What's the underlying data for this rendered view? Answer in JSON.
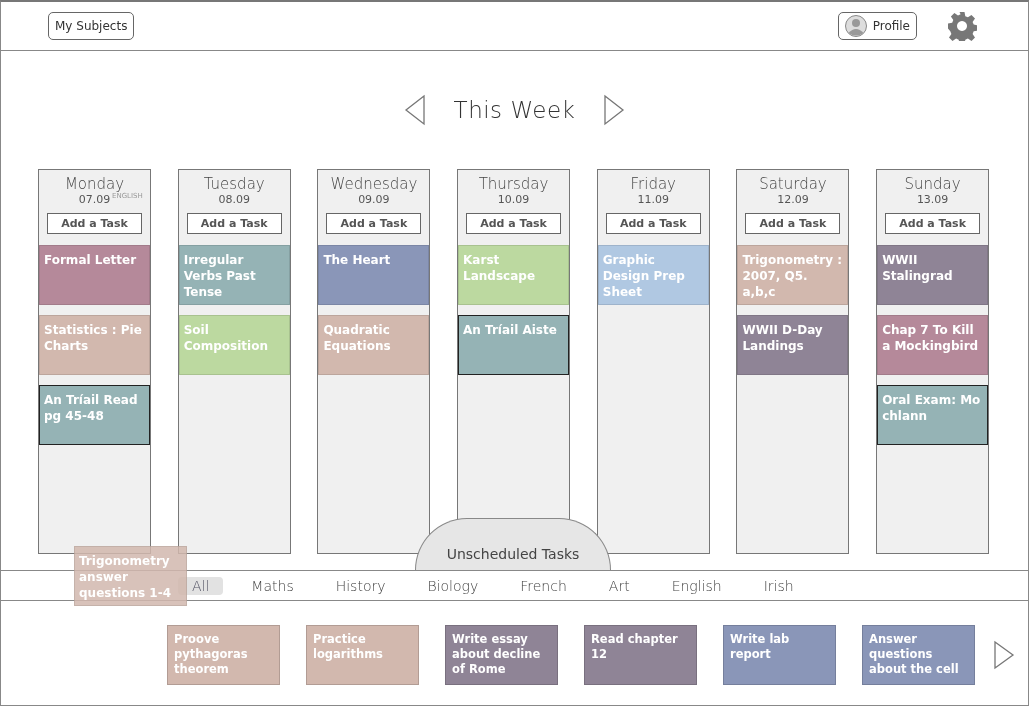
{
  "header": {
    "subjects_button": "My Subjects",
    "profile_button": "Profile"
  },
  "week": {
    "title": "This Week"
  },
  "days": [
    {
      "name": "Monday",
      "date": "07.09",
      "tag": "ENGLISH",
      "add_button": "Add a Task",
      "tasks": [
        {
          "title": "Formal  Letter",
          "color": "#b5899a",
          "outlined": false
        },
        {
          "title": "Statistics : Pie Charts",
          "color": "#d2b8ae",
          "outlined": false
        },
        {
          "title": "An Tríail Read pg 45-48",
          "color": "#95b3b5",
          "outlined": true
        }
      ]
    },
    {
      "name": "Tuesday",
      "date": "08.09",
      "add_button": "Add a Task",
      "tasks": [
        {
          "title": "Irregular Verbs Past Tense",
          "color": "#95b3b5",
          "outlined": false
        },
        {
          "title": "Soil Composition",
          "color": "#bcd9a0",
          "outlined": false
        }
      ]
    },
    {
      "name": "Wednesday",
      "date": "09.09",
      "add_button": "Add a Task",
      "tasks": [
        {
          "title": "The Heart",
          "color": "#8a96b8",
          "outlined": false
        },
        {
          "title": "Quadratic Equations",
          "color": "#d2b8ae",
          "outlined": false
        }
      ]
    },
    {
      "name": "Thursday",
      "date": "10.09",
      "add_button": "Add a Task",
      "tasks": [
        {
          "title": "Karst Landscape",
          "color": "#bcd9a0",
          "outlined": false
        },
        {
          "title": "An Tríail Aiste",
          "color": "#95b3b5",
          "outlined": true
        }
      ]
    },
    {
      "name": "Friday",
      "date": "11.09",
      "add_button": "Add a Task",
      "tasks": [
        {
          "title": "Graphic Design Prep Sheet",
          "color": "#b0c8e2",
          "outlined": false
        }
      ]
    },
    {
      "name": "Saturday",
      "date": "12.09",
      "add_button": "Add a Task",
      "tasks": [
        {
          "title": "Trigonometry : 2007, Q5. a,b,c",
          "color": "#d2b8ae",
          "outlined": false
        },
        {
          "title": "WWII D-Day Landings",
          "color": "#8f8496",
          "outlined": false
        }
      ]
    },
    {
      "name": "Sunday",
      "date": "13.09",
      "add_button": "Add a Task",
      "tasks": [
        {
          "title": "WWII Stalingrad",
          "color": "#8f8496",
          "outlined": false
        },
        {
          "title": "Chap 7 To Kill a Mockingbird",
          "color": "#b5899a",
          "outlined": false
        },
        {
          "title": "Oral Exam: Mo chlann",
          "color": "#95b3b5",
          "outlined": true
        }
      ]
    }
  ],
  "unscheduled": {
    "tab_label": "Unscheduled Tasks",
    "filters": [
      {
        "label": "All",
        "selected": true
      },
      {
        "label": "Maths",
        "selected": false
      },
      {
        "label": "History",
        "selected": false
      },
      {
        "label": "Biology",
        "selected": false
      },
      {
        "label": "French",
        "selected": false
      },
      {
        "label": "Art",
        "selected": false
      },
      {
        "label": "English",
        "selected": false
      },
      {
        "label": "Irish",
        "selected": false
      }
    ],
    "tasks": [
      {
        "title": "Proove pythagoras theorem",
        "color": "#d2b8ae"
      },
      {
        "title": "Practice logarithms",
        "color": "#d2b8ae"
      },
      {
        "title": "Write essay about decline of Rome",
        "color": "#8f8496"
      },
      {
        "title": "Read chapter 12",
        "color": "#8f8496"
      },
      {
        "title": "Write lab report",
        "color": "#8a96b8"
      },
      {
        "title": "Answer questions about the cell",
        "color": "#8a96b8"
      }
    ],
    "dragged_task": {
      "title": "Trigonometry answer questions 1-4",
      "color": "#d2b8ae"
    }
  }
}
